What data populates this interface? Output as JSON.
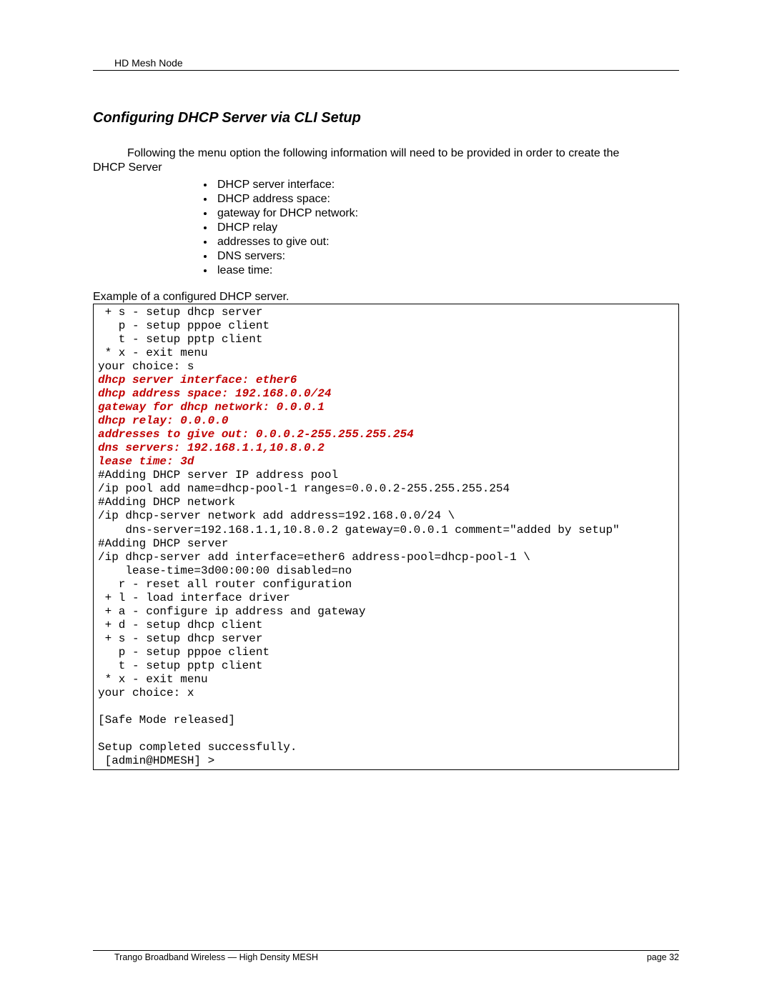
{
  "header": {
    "title": "HD Mesh Node"
  },
  "section": {
    "title": "Configuring DHCP Server via CLI Setup"
  },
  "intro": {
    "line1": "Following the menu option the following information will need to be provided in order to create the",
    "line2": "DHCP Server"
  },
  "bullets": {
    "b1": "DHCP server interface:",
    "b2": "DHCP address space:",
    "b3": "gateway for DHCP network:",
    "b4": "DHCP relay",
    "b5": "addresses to give out:",
    "b6": "DNS servers:",
    "b7": "lease time:"
  },
  "example_label": "Example of a configured DHCP server.",
  "code": {
    "l01": " + s - setup dhcp server",
    "l02": "   p - setup pppoe client",
    "l03": "   t - setup pptp client",
    "l04": " * x - exit menu",
    "l05": "your choice: s",
    "h01": "dhcp server interface: ether6",
    "h02": "dhcp address space: 192.168.0.0/24",
    "h03": "gateway for dhcp network: 0.0.0.1",
    "h04": "dhcp relay: 0.0.0.0",
    "h05": "addresses to give out: 0.0.0.2-255.255.255.254",
    "h06": "dns servers: 192.168.1.1,10.8.0.2",
    "h07": "lease time: 3d",
    "l06": "#Adding DHCP server IP address pool",
    "l07": "/ip pool add name=dhcp-pool-1 ranges=0.0.0.2-255.255.255.254",
    "l08": "#Adding DHCP network",
    "l09": "/ip dhcp-server network add address=192.168.0.0/24 \\",
    "l10": "    dns-server=192.168.1.1,10.8.0.2 gateway=0.0.0.1 comment=\"added by setup\"",
    "l11": "#Adding DHCP server",
    "l12": "/ip dhcp-server add interface=ether6 address-pool=dhcp-pool-1 \\",
    "l13": "    lease-time=3d00:00:00 disabled=no",
    "l14": "   r - reset all router configuration",
    "l15": " + l - load interface driver",
    "l16": " + a - configure ip address and gateway",
    "l17": " + d - setup dhcp client",
    "l18": " + s - setup dhcp server",
    "l19": "   p - setup pppoe client",
    "l20": "   t - setup pptp client",
    "l21": " * x - exit menu",
    "l22": "your choice: x",
    "l23": "",
    "l24": "[Safe Mode released]",
    "l25": "",
    "l26": "Setup completed successfully.",
    "l27": " [admin@HDMESH] >"
  },
  "footer": {
    "left": "Trango Broadband Wireless — High Density MESH",
    "right": "page 32"
  }
}
